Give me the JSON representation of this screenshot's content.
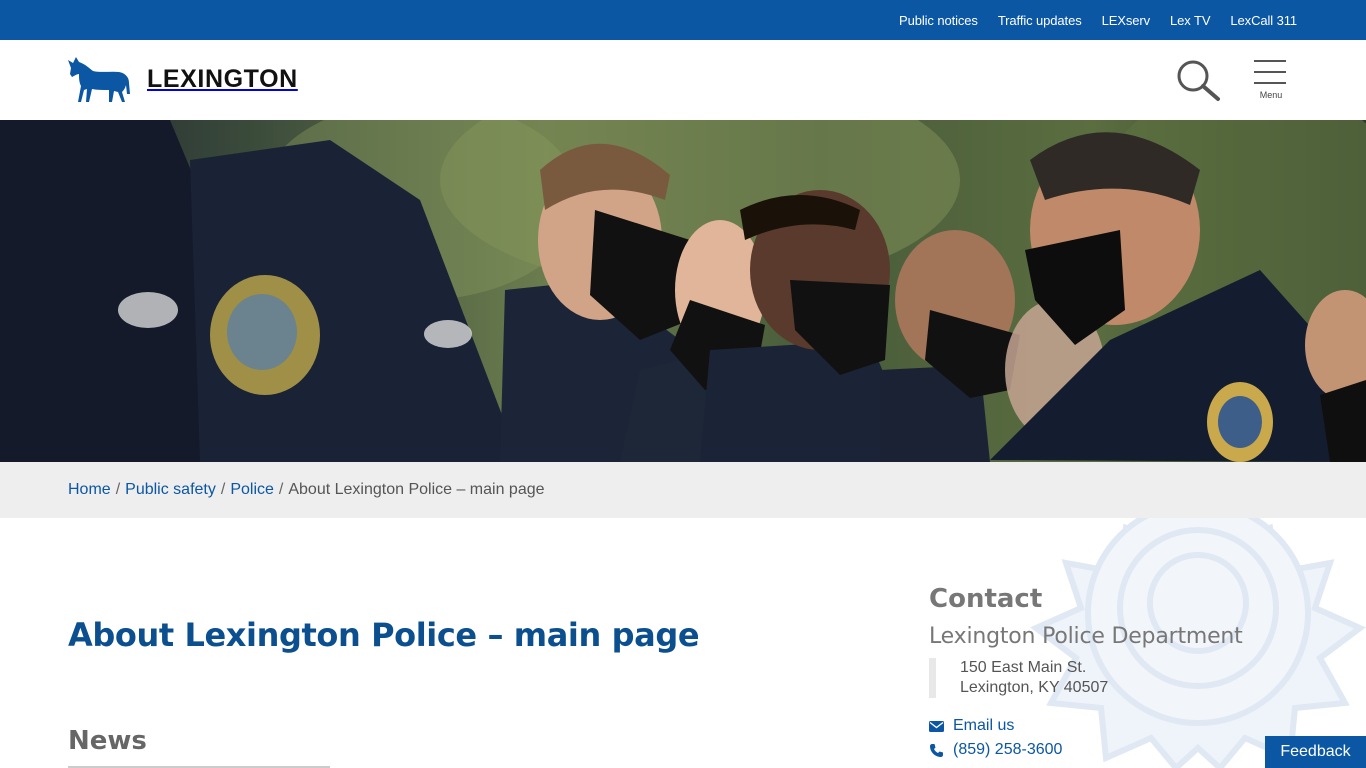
{
  "utility_links": [
    "Public notices",
    "Traffic updates",
    "LEXserv",
    "Lex TV",
    "LexCall 311"
  ],
  "header": {
    "logo_text": "LEXINGTON",
    "menu_label": "Menu",
    "icons": {
      "search": "search-icon",
      "menu": "hamburger-menu-icon",
      "logo": "horse-logo-icon"
    }
  },
  "breadcrumb": {
    "items": [
      "Home",
      "Public safety",
      "Police"
    ],
    "separator": "/",
    "current": "About Lexington Police – main page"
  },
  "main": {
    "title": "About Lexington Police – main page",
    "news_heading": "News"
  },
  "contact": {
    "heading": "Contact",
    "department": "Lexington Police Department",
    "address_line1": "150 East Main St.",
    "address_line2": "Lexington, KY  40507",
    "email_label": "Email us",
    "phone": "(859) 258-3600",
    "icons": {
      "email": "envelope-icon",
      "phone": "phone-icon"
    }
  },
  "feedback_label": "Feedback",
  "colors": {
    "brand_blue": "#0b57a4",
    "title_blue": "#0b4f8f",
    "muted_gray": "#777777",
    "breadcrumb_bg": "#eeeeee"
  }
}
